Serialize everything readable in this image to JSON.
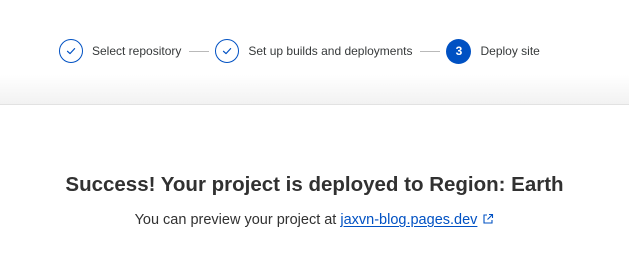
{
  "stepper": {
    "steps": [
      {
        "label": "Select repository",
        "status": "complete",
        "icon": "checkmark-icon"
      },
      {
        "label": "Set up builds and deployments",
        "status": "complete",
        "icon": "checkmark-icon"
      },
      {
        "label": "Deploy site",
        "status": "current",
        "number": "3"
      }
    ]
  },
  "main": {
    "title": "Success! Your project is deployed to Region: Earth",
    "preview_text": "You can preview your project at",
    "preview_link": "jaxvn-blog.pages.dev",
    "link_icon": "external-link-icon"
  },
  "colors": {
    "accent": "#0051c3",
    "text": "#313131",
    "connector": "#b9b9b9"
  }
}
